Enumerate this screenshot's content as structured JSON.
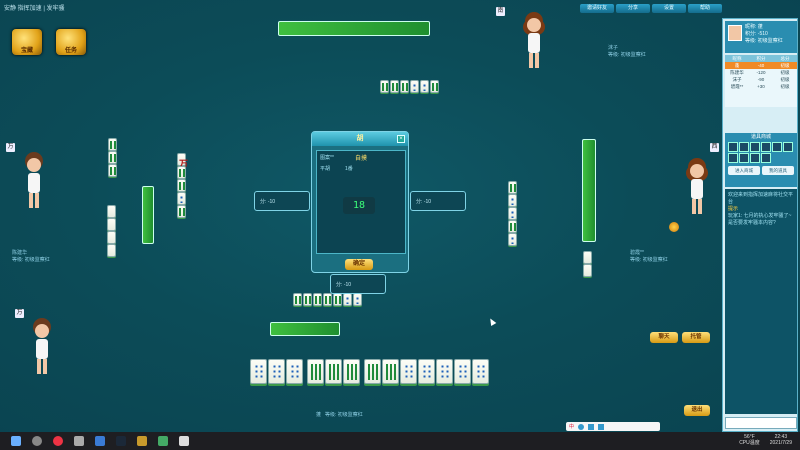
{
  "window": {
    "title": "安静 指挥加速 | 发牢骚"
  },
  "top_buttons": [
    "邀请好友",
    "分享",
    "设置",
    "帮助"
  ],
  "logos": [
    {
      "label": "宝藏",
      "icon": "treasure-chest-icon"
    },
    {
      "label": "任务",
      "icon": "gift-basket-icon"
    }
  ],
  "players": {
    "top": {
      "name": "沫子",
      "level": "等级: 初级监察红"
    },
    "left": {
      "name": "陈建华",
      "level": "等级: 初级监察红"
    },
    "right": {
      "name": "碧霞**",
      "level": "等级: 初级监察红"
    },
    "self": {
      "name": "蓬",
      "level": "等级: 初级监察红"
    }
  },
  "seat_tags": {
    "left": "万",
    "top": "南",
    "right": "西",
    "self": "万"
  },
  "dialog": {
    "title": "胡",
    "subtitle": "自摸",
    "row1_label": "图案**",
    "row2_label": "平胡",
    "row2_value": "1番",
    "timer": "18",
    "ok_label": "确定"
  },
  "scores": {
    "left": "分: -10",
    "right": "分: -10",
    "bottom": "分: -10"
  },
  "right_panel": {
    "profile": {
      "name_label": "昵称: 蓬",
      "score_label": "积分: -510",
      "level_label": "等级: 初级监察红"
    },
    "table_headers": [
      "昵称",
      "积分",
      "总分"
    ],
    "table_rows": [
      {
        "name": "蓬",
        "score": "-40",
        "total": "初级"
      },
      {
        "name": "陈建华",
        "score": "-120",
        "total": "初级"
      },
      {
        "name": "沫子",
        "score": "-90",
        "total": "初级"
      },
      {
        "name": "碧霞**",
        "score": "+30",
        "total": "初级"
      }
    ],
    "shop_title": "道具商城",
    "shop_buttons": [
      "进入商城",
      "我的道具"
    ],
    "chat_lines": [
      "欢迎来到指挥加速麻将社交平台",
      "提示",
      "玩家1: 七月的执心发牢骚了~",
      "是否要发牢骚本内容?"
    ]
  },
  "action_buttons": {
    "chat": "聊天",
    "quit": "退出",
    "ready": "托管"
  },
  "ime": {
    "label": "中"
  },
  "taskbar": {
    "weather": "56°F",
    "cpu": "CPU温度",
    "time": "22:43",
    "date": "2021/7/29"
  }
}
